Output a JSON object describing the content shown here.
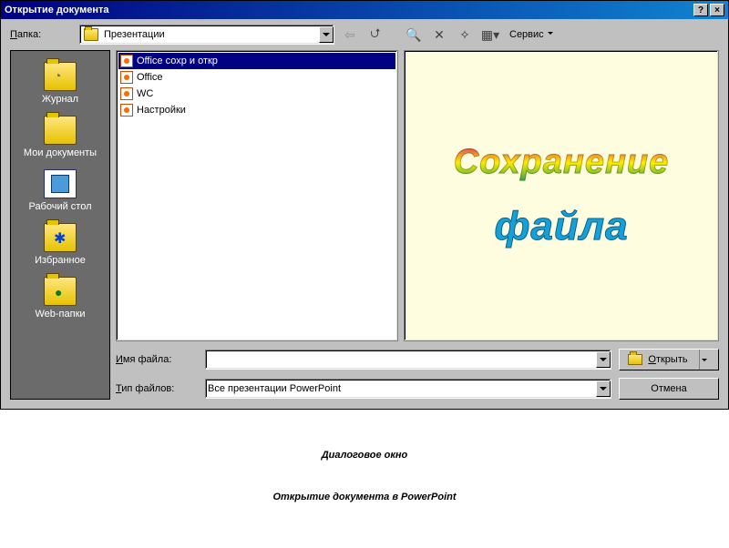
{
  "titlebar": {
    "title": "Открытие документа"
  },
  "toolbar": {
    "folder_label": "Папка:",
    "folder_underline": "П",
    "folder_value": "Презентации",
    "service": "Сервис"
  },
  "sidebar": {
    "items": [
      {
        "label": "Журнал"
      },
      {
        "label": "Мои документы"
      },
      {
        "label": "Рабочий стол"
      },
      {
        "label": "Избранное"
      },
      {
        "label": "Web-папки"
      }
    ]
  },
  "files": [
    {
      "name": "Office сохр и откр",
      "selected": true
    },
    {
      "name": "Office",
      "selected": false
    },
    {
      "name": "WC",
      "selected": false
    },
    {
      "name": "Настройки",
      "selected": false
    }
  ],
  "preview": {
    "line1": "Сохранение",
    "line2": "файла"
  },
  "form": {
    "filename_label": "Имя файла:",
    "filename_underline": "И",
    "filename_value": "",
    "filetype_label": "Тип файлов:",
    "filetype_underline": "Т",
    "filetype_value": "Все презентации PowerPoint",
    "open": "Открыть",
    "open_underline": "О",
    "cancel": "Отмена"
  },
  "caption": "Диалоговое окно\nОткрытие документа в PowerPoint"
}
